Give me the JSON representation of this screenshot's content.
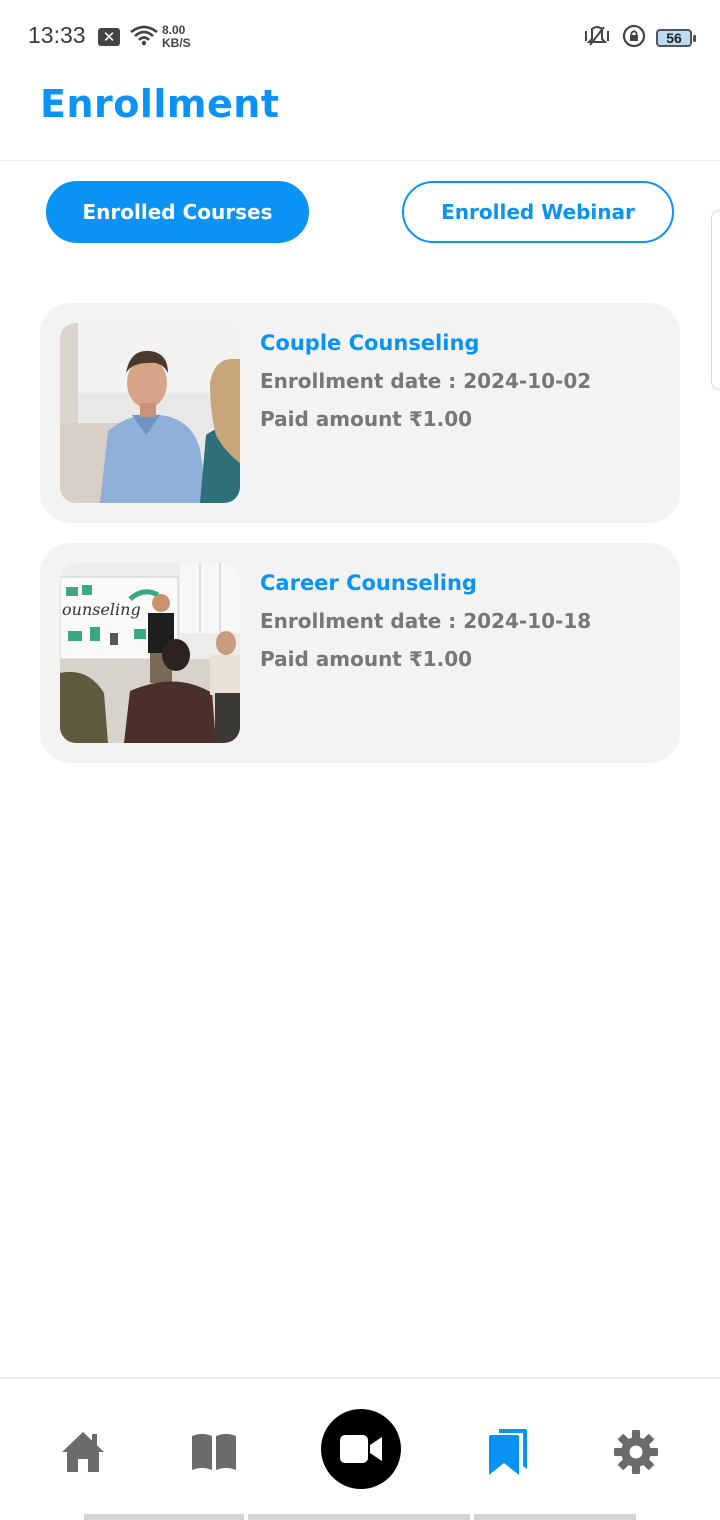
{
  "status_bar": {
    "time": "13:33",
    "notification_badge": "✕",
    "net_speed_value": "8.00",
    "net_speed_unit": "KB/S",
    "battery": "56",
    "icons": [
      "close-box-icon",
      "wifi-icon",
      "vibrate-icon",
      "rotation-lock-icon",
      "battery-icon"
    ]
  },
  "header": {
    "title": "Enrollment"
  },
  "tabs": [
    {
      "label": "Enrolled Courses",
      "active": true
    },
    {
      "label": "Enrolled Webinar",
      "active": false
    }
  ],
  "courses": [
    {
      "title": "Couple Counseling",
      "enrollment_date": "Enrollment date : 2024-10-02",
      "paid": "Paid amount ₹1.00",
      "image": "photo of a man and woman talking"
    },
    {
      "title": "Career Counseling",
      "enrollment_date": "Enrollment date : 2024-10-18",
      "paid": "Paid amount ₹1.00",
      "image": "photo of a group session with a whiteboard"
    }
  ],
  "bottom_nav": {
    "items": [
      "home-icon",
      "book-icon",
      "video-camera-icon",
      "bookmark-icon",
      "gear-icon"
    ],
    "active": "bookmark-icon"
  },
  "colors": {
    "accent": "#0a93f5",
    "card_bg": "#f3f3f3",
    "muted_text": "#777777",
    "nav_icon": "#6b6b6b"
  }
}
